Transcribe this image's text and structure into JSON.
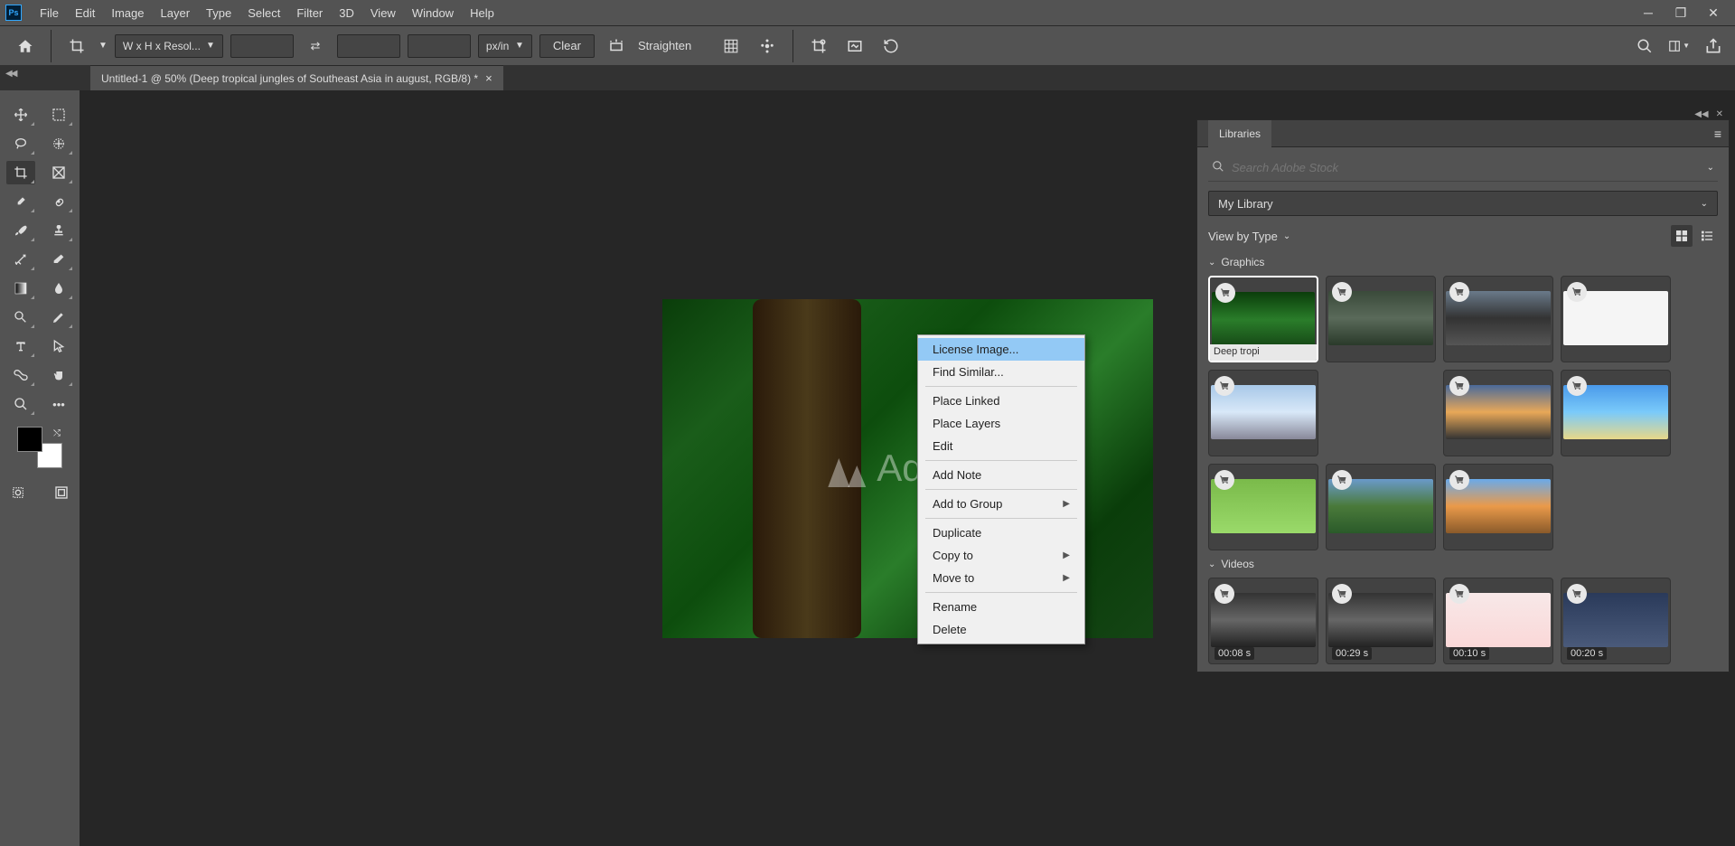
{
  "menu": [
    "File",
    "Edit",
    "Image",
    "Layer",
    "Type",
    "Select",
    "Filter",
    "3D",
    "View",
    "Window",
    "Help"
  ],
  "options": {
    "preset": "W x H x Resol...",
    "unit": "px/in",
    "clear": "Clear",
    "straighten": "Straighten"
  },
  "tab": {
    "title": "Untitled-1 @ 50% (Deep tropical jungles of Southeast Asia in august, RGB/8) *"
  },
  "watermark": "Adobe",
  "libraries": {
    "tab": "Libraries",
    "search_placeholder": "Search Adobe Stock",
    "library_name": "My Library",
    "view_label": "View by Type",
    "sections": {
      "graphics": "Graphics",
      "videos": "Videos"
    },
    "selected_label": "Deep tropi",
    "video_times": [
      "00:08 s",
      "00:29 s",
      "00:10 s",
      "00:20 s"
    ]
  },
  "context_menu": [
    {
      "label": "License Image...",
      "hl": true
    },
    {
      "label": "Find Similar..."
    },
    {
      "sep": true
    },
    {
      "label": "Place Linked"
    },
    {
      "label": "Place Layers"
    },
    {
      "label": "Edit"
    },
    {
      "sep": true
    },
    {
      "label": "Add Note"
    },
    {
      "sep": true
    },
    {
      "label": "Add to Group",
      "sub": true
    },
    {
      "sep": true
    },
    {
      "label": "Duplicate"
    },
    {
      "label": "Copy to",
      "sub": true
    },
    {
      "label": "Move to",
      "sub": true
    },
    {
      "sep": true
    },
    {
      "label": "Rename"
    },
    {
      "label": "Delete"
    }
  ]
}
